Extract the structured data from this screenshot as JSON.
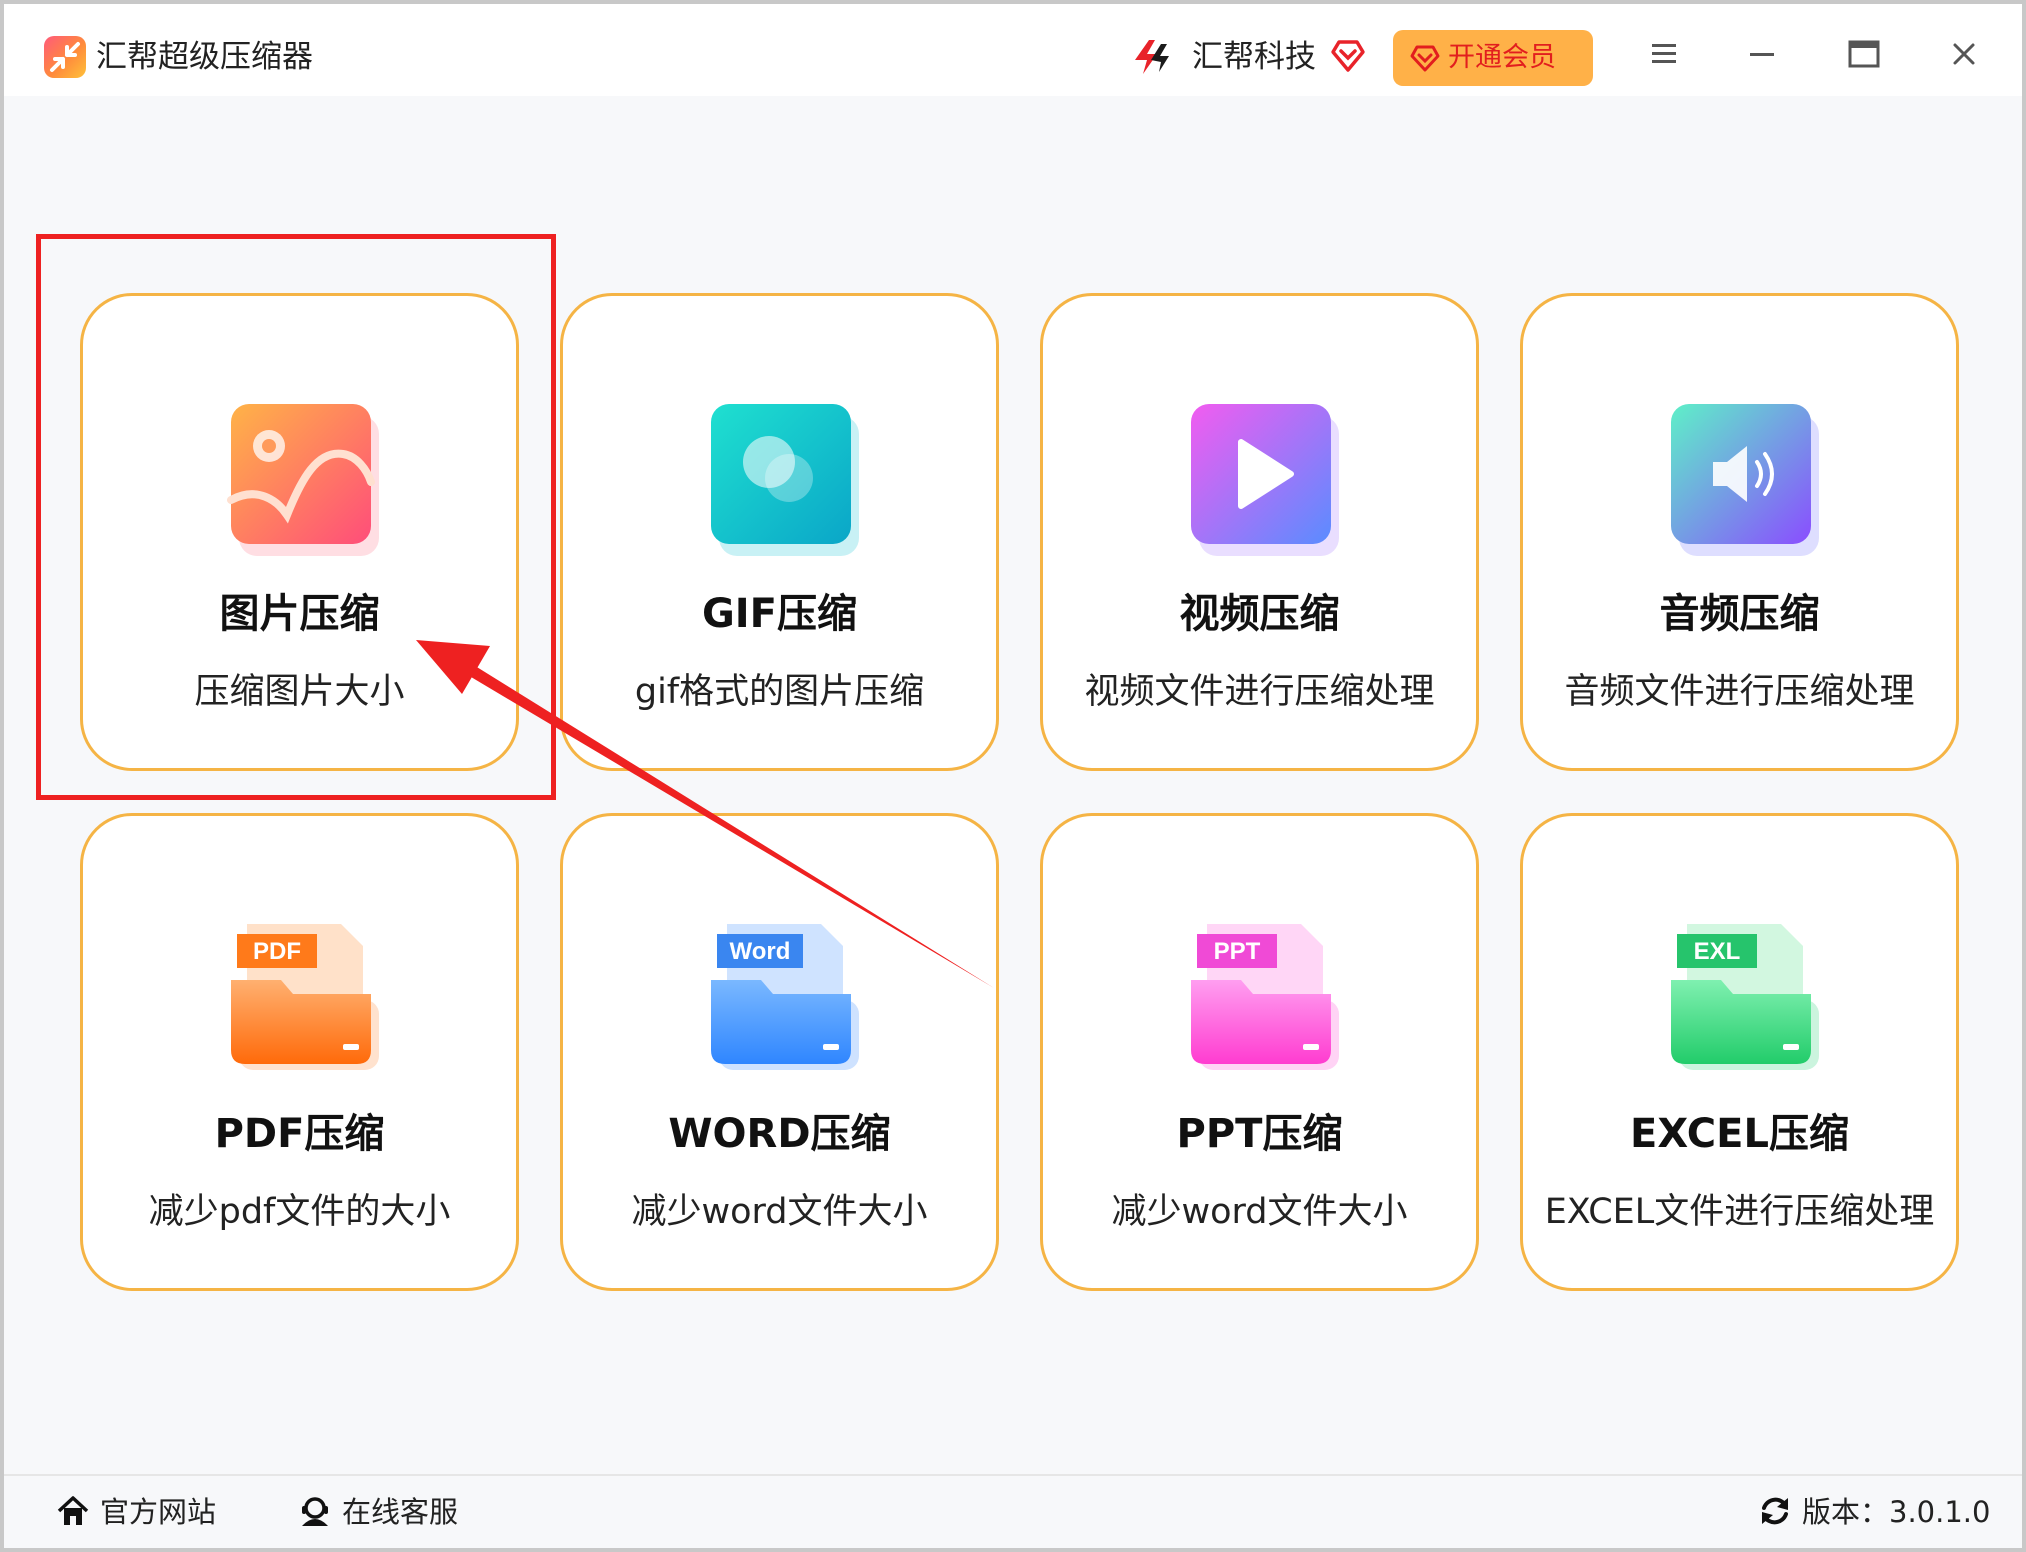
{
  "app": {
    "title": "汇帮超级压缩器",
    "brand_name": "汇帮科技",
    "vip_label": "开通会员"
  },
  "colors": {
    "accent": "#ffb148",
    "card_border": "#f5b445",
    "annotation": "#ee2121",
    "vip_text": "#e21e1e"
  },
  "cards": [
    {
      "title": "图片压缩",
      "desc": "压缩图片大小",
      "icon": "image-icon"
    },
    {
      "title": "GIF压缩",
      "desc": "gif格式的图片压缩",
      "icon": "gif-icon"
    },
    {
      "title": "视频压缩",
      "desc": "视频文件进行压缩处理",
      "icon": "video-icon"
    },
    {
      "title": "音频压缩",
      "desc": "音频文件进行压缩处理",
      "icon": "audio-icon"
    },
    {
      "title": "PDF压缩",
      "desc": "减少pdf文件的大小",
      "icon": "pdf-icon",
      "badge": "PDF"
    },
    {
      "title": "WORD压缩",
      "desc": "减少word文件大小",
      "icon": "word-icon",
      "badge": "Word"
    },
    {
      "title": "PPT压缩",
      "desc": "减少word文件大小",
      "icon": "ppt-icon",
      "badge": "PPT"
    },
    {
      "title": "EXCEL压缩",
      "desc": "EXCEL文件进行压缩处理",
      "icon": "excel-icon",
      "badge": "EXL"
    }
  ],
  "footer": {
    "website": "官方网站",
    "service": "在线客服",
    "version": "版本：3.0.1.0"
  }
}
